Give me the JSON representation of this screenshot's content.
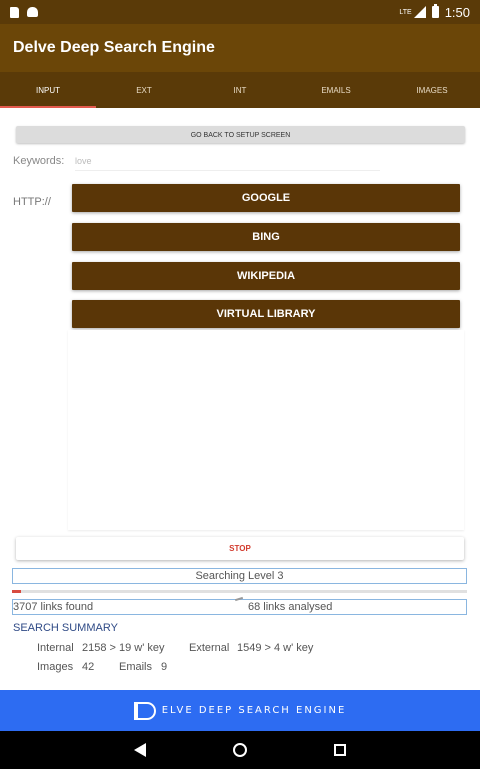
{
  "status_bar": {
    "time": "1:50",
    "network_label": "LTE"
  },
  "app": {
    "title": "Delve Deep Search Engine"
  },
  "tabs": [
    {
      "label": "INPUT",
      "active": true
    },
    {
      "label": "EXT",
      "active": false
    },
    {
      "label": "INT",
      "active": false
    },
    {
      "label": "EMAILS",
      "active": false
    },
    {
      "label": "IMAGES",
      "active": false
    }
  ],
  "setup_button_label": "GO BACK TO SETUP SCREEN",
  "keywords": {
    "label": "Keywords:",
    "value": "love"
  },
  "http_label": "HTTP://",
  "engines": [
    "GOOGLE",
    "BING",
    "WIKIPEDIA",
    "VIRTUAL LIBRARY"
  ],
  "stop_label": "STOP",
  "level_text": "Searching Level 3",
  "progress_fraction": 0.02,
  "links": {
    "found": "3707 links found",
    "analysed": "68 links analysed"
  },
  "summary": {
    "title": "SEARCH SUMMARY",
    "internal_label": "Internal",
    "internal_value": "2158 > 19 w' key",
    "external_label": "External",
    "external_value": "1549 > 4 w' key",
    "images_label": "Images",
    "images_value": "42",
    "emails_label": "Emails",
    "emails_value": "9"
  },
  "banner_text": "ELVE DEEP SEARCH ENGINE",
  "colors": {
    "app_bar": "#6b4608",
    "tab_bar": "#5a3a08",
    "button": "#5a3607",
    "accent": "#e45a4e",
    "banner": "#2d6cf2"
  }
}
